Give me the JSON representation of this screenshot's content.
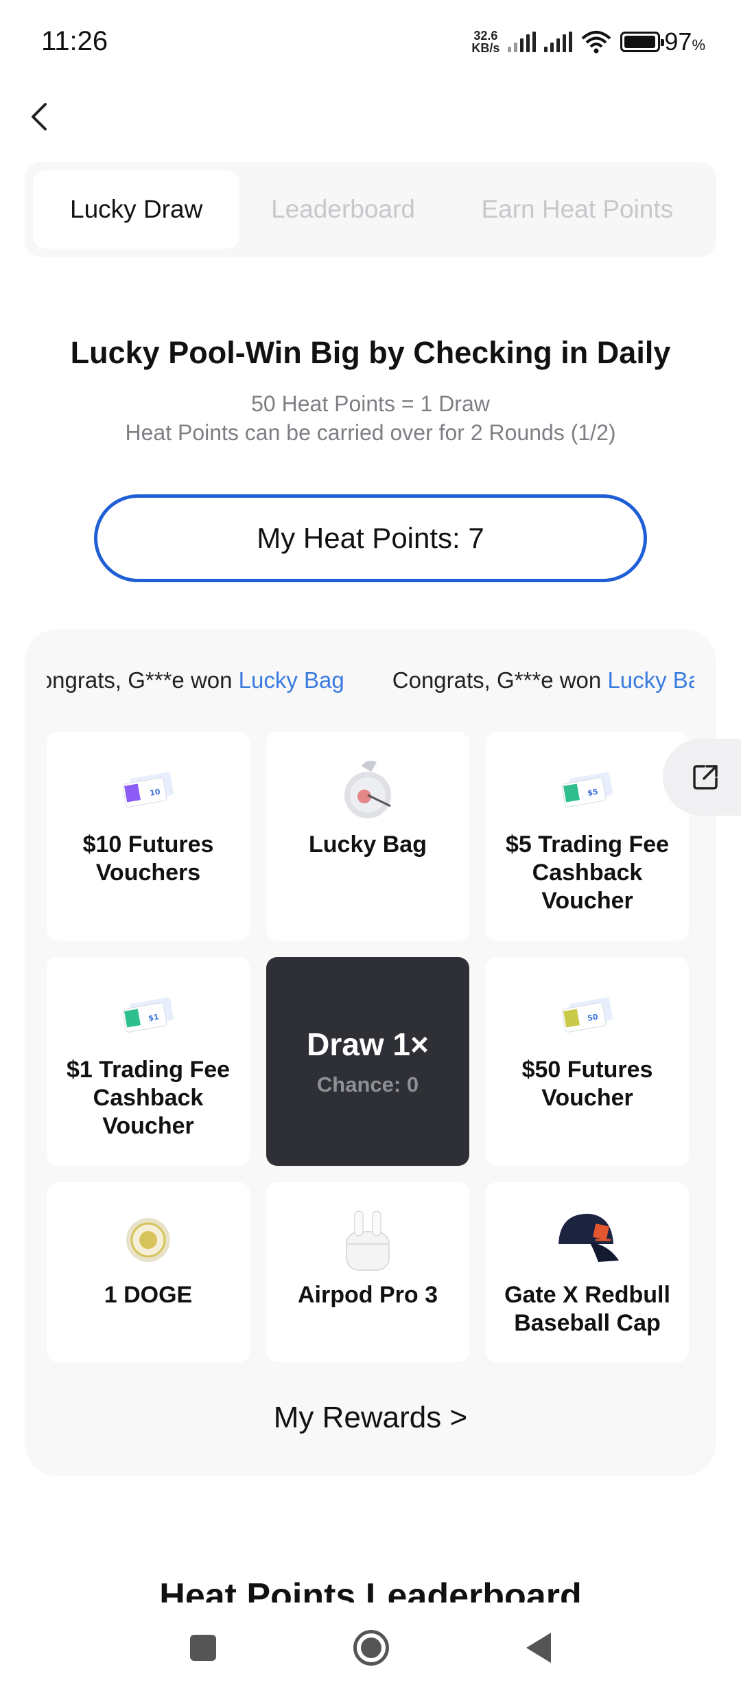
{
  "status_bar": {
    "time": "11:26",
    "net_speed_value": "32.6",
    "net_speed_unit": "KB/s",
    "battery_percent": "97",
    "battery_unit": "%",
    "battery_level": 0.97
  },
  "tabs": [
    {
      "label": "Lucky Draw",
      "active": true
    },
    {
      "label": "Leaderboard",
      "active": false
    },
    {
      "label": "Earn Heat Points",
      "active": false
    }
  ],
  "header": {
    "title": "Lucky Pool-Win Big by Checking in Daily",
    "subtitle_1": "50 Heat Points = 1 Draw",
    "subtitle_2": "Heat Points can be carried over for 2 Rounds (1/2)"
  },
  "points": {
    "label": "My Heat Points: 7"
  },
  "marquee": [
    {
      "prefix": "Congrats, G***e won ",
      "prize": "Lucky Bag"
    },
    {
      "prefix": "Congrats, G***e won ",
      "prize": "Lucky Bag"
    }
  ],
  "prizes": [
    {
      "label": "$10 Futures Vouchers",
      "icon": "voucher-10-icon",
      "color": "#8b5cf6",
      "badge": "10"
    },
    {
      "label": "Lucky Bag",
      "icon": "lucky-bag-icon",
      "color": "#e46b6b",
      "badge": ""
    },
    {
      "label": "$5 Trading Fee Cashback Voucher",
      "icon": "voucher-5-icon",
      "color": "#2fbf8f",
      "badge": "$5"
    },
    {
      "label": "$1 Trading Fee Cashback Voucher",
      "icon": "voucher-1-icon",
      "color": "#2fbf8f",
      "badge": "$1"
    },
    {
      "label": "$50 Futures Voucher",
      "icon": "voucher-50-icon",
      "color": "#c9c94a",
      "badge": "50"
    },
    {
      "label": "1 DOGE",
      "icon": "doge-coin-icon",
      "color": "#d8c35a",
      "badge": ""
    },
    {
      "label": "Airpod Pro 3",
      "icon": "airpods-icon",
      "color": "#eeeeee",
      "badge": ""
    },
    {
      "label": "Gate X Redbull Baseball Cap",
      "icon": "baseball-cap-icon",
      "color": "#1c2440",
      "badge": ""
    }
  ],
  "draw": {
    "title": "Draw 1×",
    "chance": "Chance: 0"
  },
  "rewards_link": "My Rewards >",
  "leaderboard_heading": "Heat Points Leaderboard",
  "colors": {
    "accent_blue": "#1f5fd6",
    "link_blue": "#3a7be0",
    "draw_bg": "#2f3035"
  }
}
